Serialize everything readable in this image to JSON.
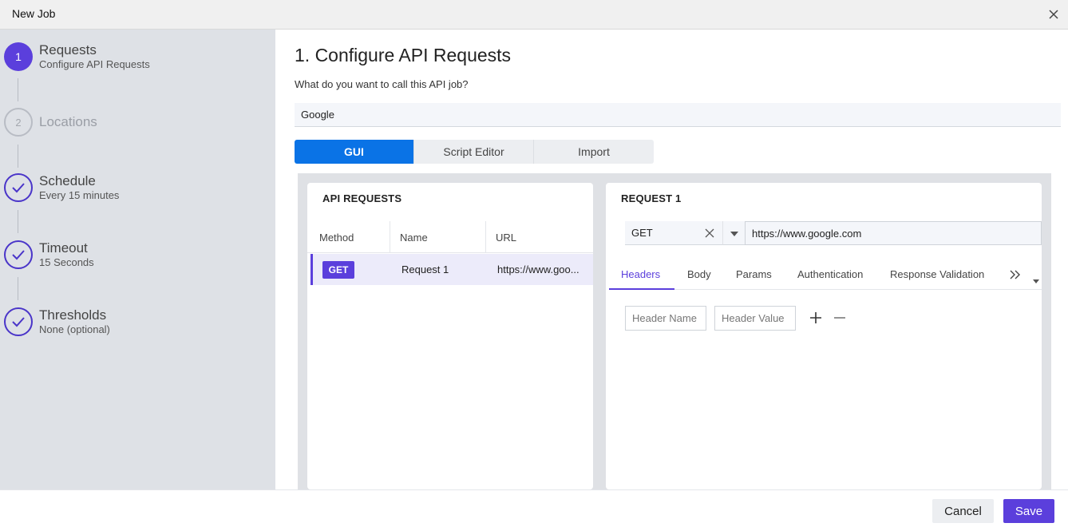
{
  "window": {
    "title": "New Job"
  },
  "steps": [
    {
      "number": "1",
      "label": "Requests",
      "sub": "Configure API Requests",
      "state": "active"
    },
    {
      "number": "2",
      "label": "Locations",
      "sub": "",
      "state": "pending"
    },
    {
      "number": "",
      "label": "Schedule",
      "sub": "Every 15 minutes",
      "state": "done"
    },
    {
      "number": "",
      "label": "Timeout",
      "sub": "15 Seconds",
      "state": "done"
    },
    {
      "number": "",
      "label": "Thresholds",
      "sub": "None (optional)",
      "state": "done"
    }
  ],
  "main": {
    "heading": "1. Configure API Requests",
    "question": "What do you want to call this API job?",
    "job_name": "Google",
    "modes": [
      "GUI",
      "Script Editor",
      "Import"
    ],
    "active_mode": "GUI"
  },
  "requests_panel": {
    "title": "API REQUESTS",
    "columns": [
      "Method",
      "Name",
      "URL"
    ],
    "rows": [
      {
        "method": "GET",
        "name": "Request 1",
        "url": "https://www.goo..."
      }
    ]
  },
  "request_detail": {
    "title": "REQUEST 1",
    "method": "GET",
    "url": "https://www.google.com",
    "tabs": [
      "Headers",
      "Body",
      "Params",
      "Authentication",
      "Response Validation"
    ],
    "active_tab": "Headers",
    "header_name_placeholder": "Header Name",
    "header_value_placeholder": "Header Value"
  },
  "footer": {
    "cancel": "Cancel",
    "save": "Save"
  },
  "colors": {
    "accent": "#5b3fdc",
    "primary_blue": "#0a73e6",
    "sidebar_bg": "#dee1e6"
  },
  "icons": [
    "close-icon",
    "check-icon",
    "clear-icon",
    "caret-down-icon",
    "double-chevron-right-icon",
    "plus-icon",
    "minus-icon"
  ]
}
